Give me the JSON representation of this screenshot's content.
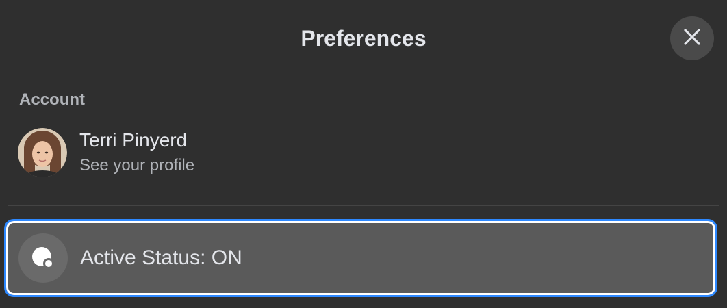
{
  "dialog": {
    "title": "Preferences",
    "close_icon": "close-icon"
  },
  "account": {
    "section_label": "Account",
    "name": "Terri Pinyerd",
    "subtitle": "See your profile",
    "avatar_icon": "avatar"
  },
  "status": {
    "label": "Active Status: ON",
    "icon": "active-status-icon",
    "focus_ring_color": "#2d88ff"
  }
}
